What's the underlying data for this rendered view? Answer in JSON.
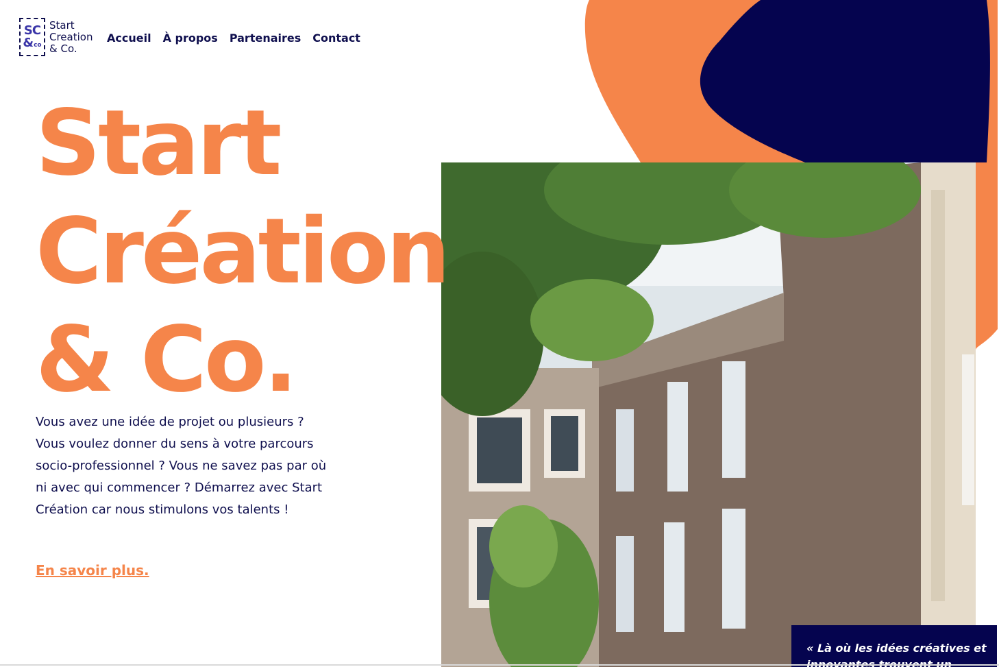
{
  "logo": {
    "mark_top": "SC",
    "mark_bottom": "&",
    "mark_side": "co",
    "text_line1": "Start",
    "text_line2": "Creation",
    "text_line3": "& Co."
  },
  "nav": {
    "items": [
      {
        "label": "Accueil"
      },
      {
        "label": "À propos"
      },
      {
        "label": "Partenaires"
      },
      {
        "label": "Contact"
      }
    ]
  },
  "hero": {
    "title_line1": "Start",
    "title_line2": "Création",
    "title_line3": "& Co.",
    "intro": "Vous avez une idée de projet ou plusieurs ? Vous voulez donner du sens à votre parcours socio-professionnel ? Vous ne savez pas par où ni avec qui commencer ? Démarrez avec Start Création car nous stimulons vos talents !",
    "more_link": "En savoir plus."
  },
  "quote": {
    "text": "« Là où les idées créatives et innovantes trouvent un"
  },
  "colors": {
    "accent": "#f5854a",
    "navy": "#05044f",
    "text": "#0f0f4e"
  }
}
